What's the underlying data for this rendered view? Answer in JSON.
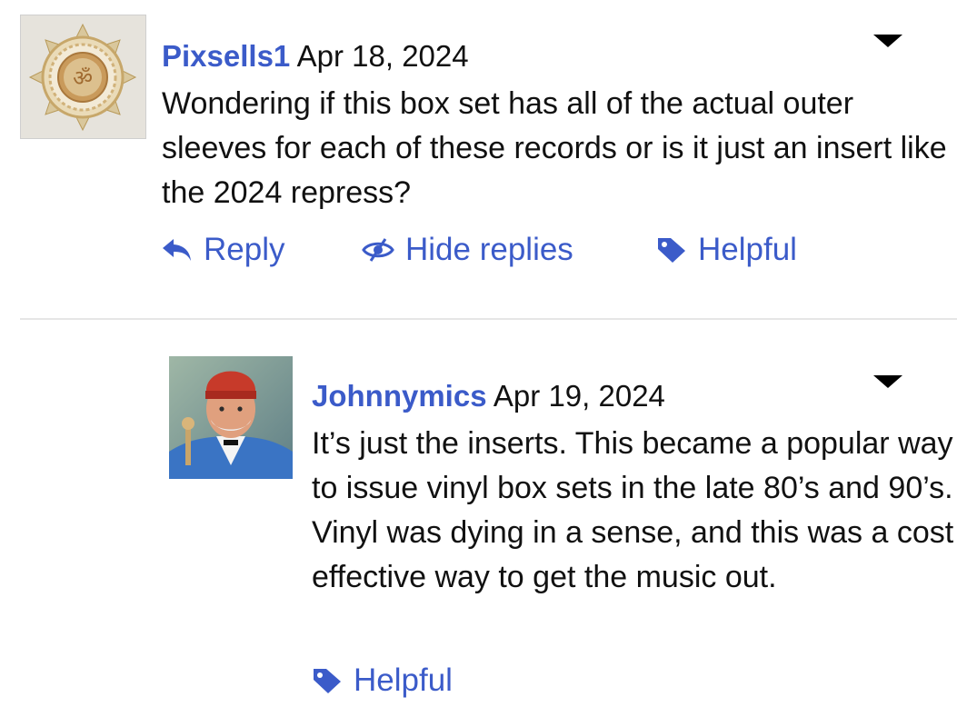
{
  "comments": [
    {
      "username": "Pixsells1",
      "date": "Apr 18, 2024",
      "text": "Wondering if this box set has all of the actual outer sleeves for each of these records or is it just an insert like the 2024 repress?",
      "actions": {
        "reply": "Reply",
        "hide_replies": "Hide replies",
        "helpful": "Helpful"
      },
      "avatar_icon": "mandala-avatar"
    },
    {
      "username": "Johnnymics",
      "date": "Apr 19, 2024",
      "text": "It’s just the inserts. This became a popular way to issue vinyl box sets in the late 80’s and 90’s. Vinyl was dying in a sense, and this was a cost effective way to get the music out.",
      "actions": {
        "helpful": "Helpful"
      },
      "avatar_icon": "portrait-avatar"
    }
  ],
  "colors": {
    "link": "#3b5bc9",
    "text": "#111111",
    "divider": "#e6e6e6"
  }
}
